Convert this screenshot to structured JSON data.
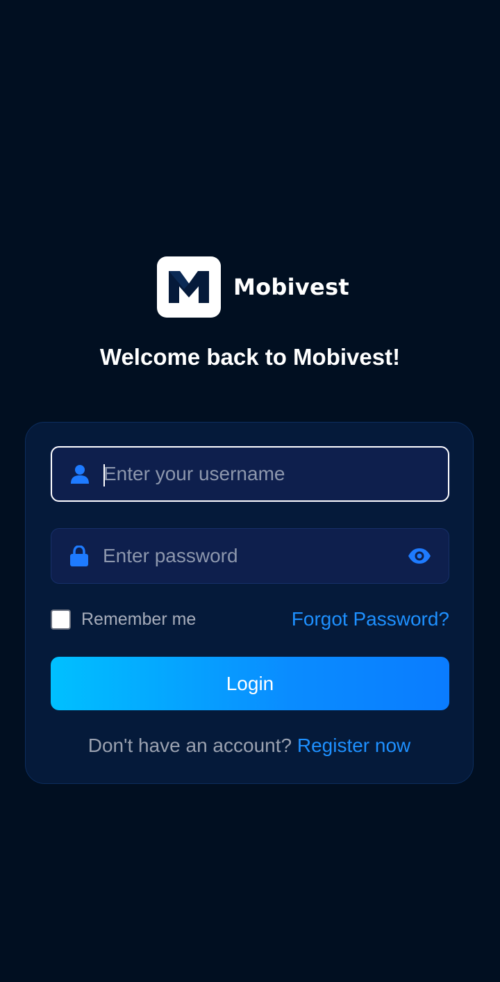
{
  "brand": {
    "logo_icon": "m-logo-icon",
    "name": "Mobivest"
  },
  "welcome": {
    "title": "Welcome back to Mobivest!"
  },
  "login_form": {
    "username": {
      "icon": "user-icon",
      "placeholder": "Enter your username",
      "value": ""
    },
    "password": {
      "icon": "lock-icon",
      "placeholder": "Enter password",
      "value": "",
      "toggle_icon": "eye-icon"
    },
    "remember_me": {
      "label": "Remember me",
      "checked": false
    },
    "forgot_password_label": "Forgot Password?",
    "login_label": "Login",
    "register_prompt": "Don't have an account?",
    "register_link": "Register now"
  },
  "colors": {
    "background": "#010f21",
    "card": "#051a3a",
    "input": "#0e1f4d",
    "accent": "#1e90ff",
    "button_gradient_start": "#00c0ff",
    "button_gradient_end": "#0a7cff"
  }
}
